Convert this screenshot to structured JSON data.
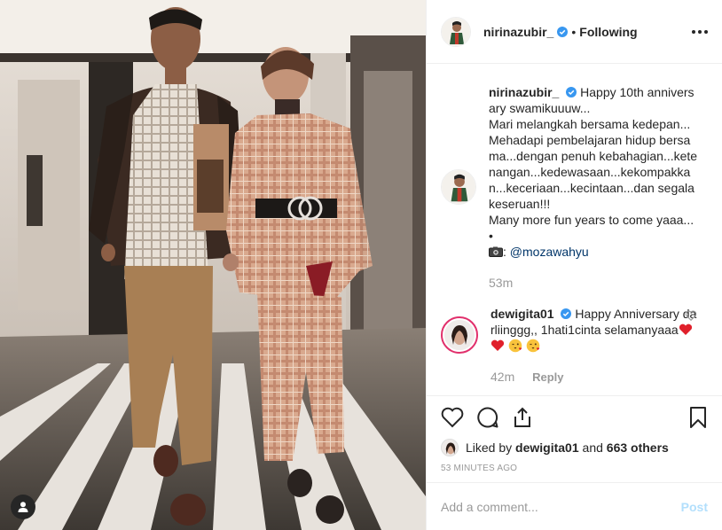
{
  "post": {
    "username": "nirinazubir_",
    "separator": "•",
    "follow_status": "Following"
  },
  "caption": {
    "username": "nirinazubir_",
    "lines": [
      "Happy 10th anniversary swamikuuuw...",
      "Mari melangkah bersama kedepan...",
      "Mehadapi pembelajaran hidup bersama...dengan penuh kebahagian...ketenangan...kedewasaan...kekompakkan...keceriaan...kecintaan...dan segala keseruan!!!",
      "Many more fun years to come yaaa...",
      "•"
    ],
    "credit_icon": "camera-emoji",
    "credit_sep": ":",
    "credit_mention": "@mozawahyu",
    "time": "53m"
  },
  "comment": {
    "username": "dewigita01",
    "text": "Happy Anniversary darliinggg,, 1hati1cinta selamanyaaa",
    "emoji": [
      "heart-emoji",
      "heart-emoji",
      "kissing-face-emoji",
      "kissing-face-emoji"
    ],
    "time": "42m",
    "reply_label": "Reply"
  },
  "likes": {
    "prefix": "Liked by",
    "liker": "dewigita01",
    "conj": "and",
    "others": "663 others"
  },
  "timeago": "53 MINUTES AGO",
  "add_comment": {
    "placeholder": "Add a comment...",
    "post_label": "Post"
  },
  "colors": {
    "verified_blue": "#3897f0",
    "post_button": "#b2dffc",
    "link": "#003569",
    "muted": "#999999"
  }
}
